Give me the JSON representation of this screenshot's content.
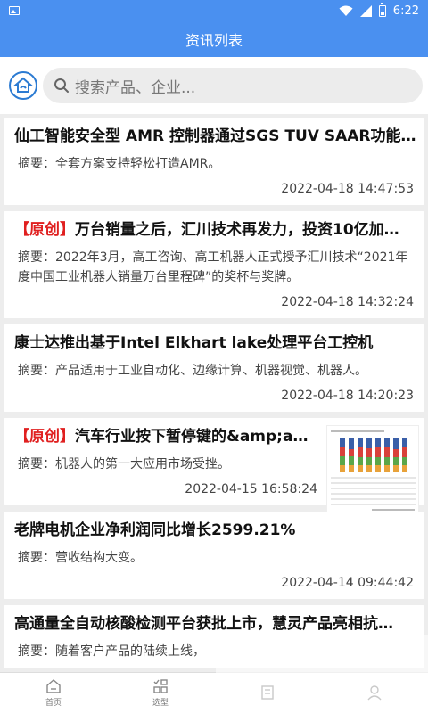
{
  "status_bar": {
    "time": "6:22",
    "left_icon": "image-icon",
    "right_icons": [
      "wifi-icon",
      "signal-icon",
      "battery-icon"
    ]
  },
  "header": {
    "title": "资讯列表"
  },
  "search": {
    "placeholder": "搜索产品、企业..."
  },
  "articles": [
    {
      "tag": "",
      "title": "仙工智能安全型 AMR 控制器通过SGS TUV SAAR功能安…",
      "summary": "摘要：全套方案支持轻松打造AMR。",
      "date": "2022-04-18 14:47:53"
    },
    {
      "tag": "【原创】",
      "title": "万台销量之后，汇川技术再发力，投资10亿加…",
      "summary": "摘要：2022年3月，高工咨询、高工机器人正式授予汇川技术“2021年度中国工业机器人销量万台里程碑”的奖杯与奖牌。",
      "date": "2022-04-18 14:32:24"
    },
    {
      "tag": "",
      "title": "康士达推出基于Intel Elkhart lake处理平台工控机",
      "summary": "摘要：产品适用于工业自动化、边缘计算、机器视觉、机器人。",
      "date": "2022-04-18 14:20:23"
    },
    {
      "tag": "【原创】",
      "title": "汽车行业按下暂停键的&amp;amp…",
      "summary": "摘要：机器人的第一大应用市场受挫。",
      "date": "2022-04-15 16:58:24",
      "has_thumbnail": true
    },
    {
      "tag": "",
      "title": "老牌电机企业净利润同比增长2599.21%",
      "summary": "摘要：营收结构大变。",
      "date": "2022-04-14 09:44:42"
    },
    {
      "tag": "",
      "title": "高通量全自动核酸检测平台获批上市，慧灵产品亮相抗…",
      "summary": "摘要：随着客户产品的陆续上线，",
      "date": ""
    }
  ],
  "tabbar": {
    "items": [
      {
        "label": "首页",
        "icon": "home-icon"
      },
      {
        "label": "选型",
        "icon": "grid-icon"
      },
      {
        "label": "",
        "icon": "news-icon"
      },
      {
        "label": "",
        "icon": "user-icon"
      }
    ]
  },
  "colors": {
    "primary": "#4a90f0",
    "tag_red": "#e02020",
    "background": "#ededed"
  }
}
